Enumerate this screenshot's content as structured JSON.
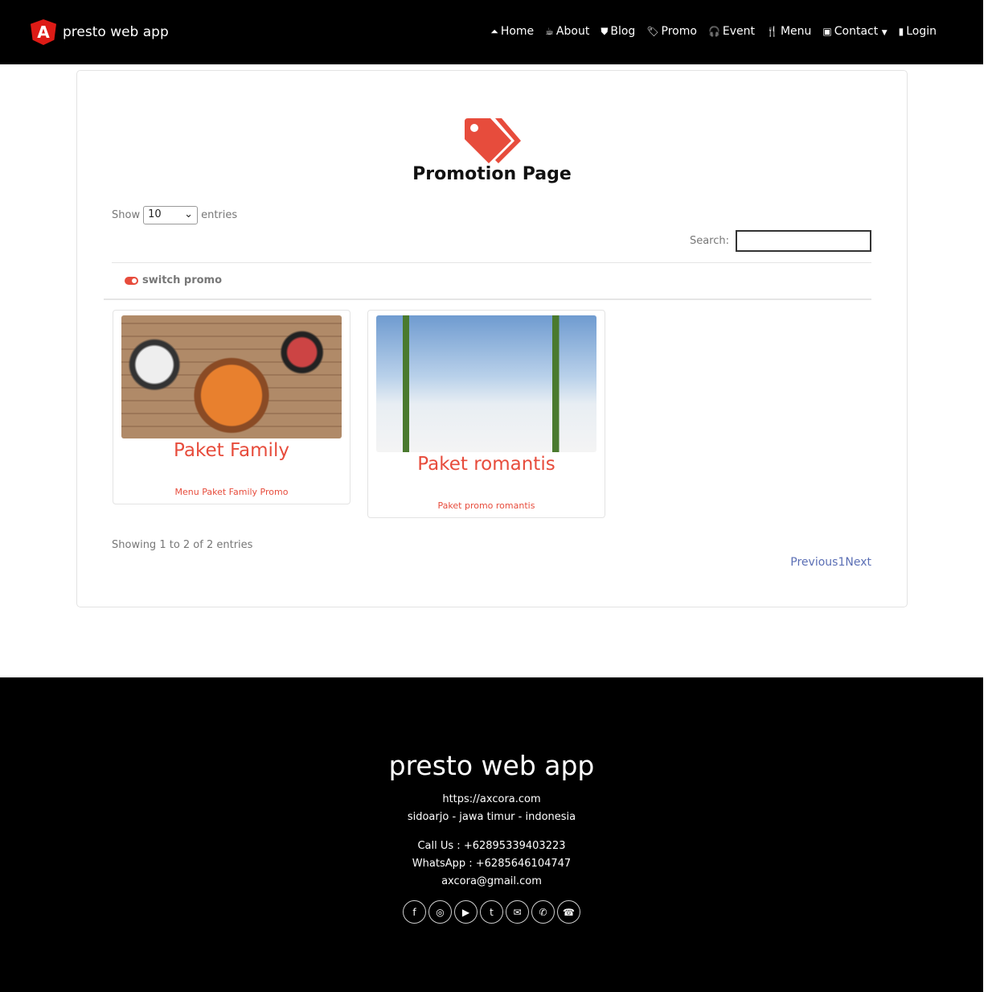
{
  "brand": "presto web app",
  "nav": [
    {
      "label": "Home",
      "icon": "bell-icon"
    },
    {
      "label": "About",
      "icon": "coffee-icon"
    },
    {
      "label": "Blog",
      "icon": "angular-icon"
    },
    {
      "label": "Promo",
      "icon": "tags-icon"
    },
    {
      "label": "Event",
      "icon": "headphones-icon"
    },
    {
      "label": "Menu",
      "icon": "utensils-icon"
    },
    {
      "label": "Contact",
      "icon": "id-badge-icon"
    },
    {
      "label": "Login",
      "icon": "mobile-icon"
    }
  ],
  "page": {
    "title": "Promotion Page",
    "show": "Show",
    "length": "10",
    "entries": "entries",
    "search_label": "Search:",
    "switch": "switch promo",
    "cards": [
      {
        "title": "Paket Family",
        "desc": "Menu Paket Family Promo"
      },
      {
        "title": "Paket romantis",
        "desc": "Paket promo romantis"
      }
    ],
    "info": "Showing 1 to 2 of 2 entries",
    "prev": "Previous",
    "num": "1",
    "next": "Next"
  },
  "footer": {
    "title": "presto web app",
    "url": "https://axcora.com",
    "address": "sidoarjo - jawa timur - indonesia",
    "call": "Call Us : +62895339403223",
    "wa": "WhatsApp : +6285646104747",
    "email": "axcora@gmail.com"
  },
  "colors": {
    "accent": "#e74c3c",
    "link": "#5b6fb5"
  }
}
